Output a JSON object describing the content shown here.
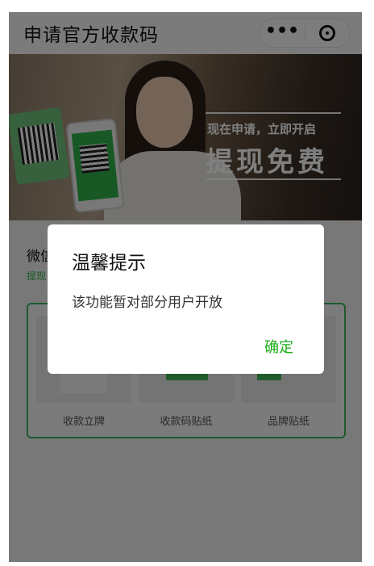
{
  "navbar": {
    "title": "申请官方收款码",
    "more_icon": "more-dots-icon",
    "more_label": "•••",
    "close_icon": "target-close-icon"
  },
  "banner": {
    "slogan_small": "现在申请，立即开启",
    "slogan_big": "提现免费"
  },
  "intro": {
    "title": "微信",
    "link": "提现"
  },
  "products": [
    {
      "label": "收款立牌"
    },
    {
      "label": "收款码贴纸"
    },
    {
      "label": "品牌贴纸"
    }
  ],
  "dialog": {
    "title": "温馨提示",
    "message": "该功能暂对部分用户开放",
    "confirm_label": "确定",
    "confirm_color": "#1aad19"
  },
  "colors": {
    "accent_green": "#3fb45a",
    "overlay": "rgba(0,0,0,0.5)"
  }
}
